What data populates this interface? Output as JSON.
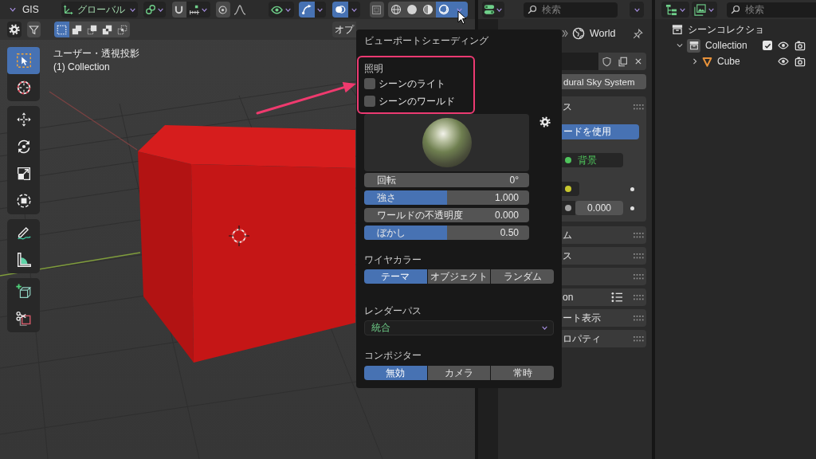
{
  "viewport_header": {
    "menu_label": "GIS",
    "orientation": {
      "value": "グローバル"
    },
    "snap": {
      "on": false
    },
    "proportional_editing": {
      "on": false
    },
    "gizmos": {
      "on": true
    },
    "overlays": {
      "on": true
    },
    "xray": {
      "on": false
    },
    "shading_modes": [
      {
        "selected": false
      },
      {
        "selected": false
      },
      {
        "selected": false
      },
      {
        "selected": true
      }
    ],
    "shading_menu": {
      "expanded": true
    }
  },
  "tool_header": {
    "select_modes": [
      {
        "selected": true
      },
      {
        "selected": false
      },
      {
        "selected": false
      },
      {
        "selected": false
      },
      {
        "selected": false
      }
    ],
    "options_button": "オプ"
  },
  "viewport": {
    "view_name": "ユーザー・透視投影",
    "collection_label": "(1) Collection",
    "toolbar": [
      {
        "tools": [
          {
            "selected": true
          },
          {
            "selected": false
          }
        ]
      },
      {
        "tools": [
          {
            "selected": false
          },
          {
            "selected": false
          },
          {
            "selected": false
          },
          {
            "selected": false
          }
        ]
      },
      {
        "tools": [
          {
            "selected": false
          },
          {
            "selected": false
          }
        ]
      },
      {
        "tools": [
          {
            "selected": false
          },
          {
            "selected": false
          }
        ]
      }
    ]
  },
  "viewport_shading": {
    "title": "ビューポートシェーディング",
    "lighting": {
      "label": "照明",
      "highlighted": true,
      "options": [
        {
          "label": "シーンのライト",
          "checked": false
        },
        {
          "label": "シーンのワールド",
          "checked": false
        }
      ]
    },
    "sliders": [
      {
        "kind": "number",
        "label": "回転",
        "value": "0°"
      },
      {
        "kind": "slider",
        "label": "強さ",
        "value": "1.000",
        "level": 0.5
      },
      {
        "kind": "number",
        "label": "ワールドの不透明度",
        "value": "0.000"
      },
      {
        "kind": "slider",
        "label": "ぼかし",
        "value": "0.50",
        "level": 0.5
      }
    ],
    "wire_color": {
      "label": "ワイヤカラー",
      "options": [
        {
          "label": "テーマ",
          "selected": true
        },
        {
          "label": "オブジェクト",
          "selected": false
        },
        {
          "label": "ランダム",
          "selected": false
        }
      ]
    },
    "render_pass": {
      "label": "レンダーパス",
      "value": "統合"
    },
    "compositor": {
      "label": "コンポジター",
      "options": [
        {
          "label": "無効",
          "selected": true
        },
        {
          "label": "カメラ",
          "selected": false
        },
        {
          "label": "常時",
          "selected": false
        }
      ]
    }
  },
  "properties": {
    "search": {
      "placeholder": "検索"
    },
    "breadcrumb": "World",
    "node_tree_button": "dural Sky System",
    "panels": [
      {
        "title": "ス",
        "expanded": true,
        "use_nodes": {
          "label": "ードを使用",
          "on": true
        },
        "sockets": [
          {
            "kind": "shader",
            "label": "背景",
            "color": "#4fc45c"
          },
          {
            "kind": "color",
            "color": "#c7c72e"
          },
          {
            "kind": "value",
            "color": "#a1a1a1",
            "value": "0.000"
          }
        ]
      },
      {
        "title": "ム",
        "expanded": false,
        "menu_icon": false
      },
      {
        "title": "ス",
        "expanded": false,
        "menu_icon": false
      },
      {
        "expanded": false,
        "menu_icon": false
      },
      {
        "title": "on",
        "expanded": false,
        "menu_icon": true
      },
      {
        "title": "ート表示",
        "expanded": false,
        "menu_icon": false
      },
      {
        "title": "ロパティ",
        "expanded": false,
        "menu_icon": false
      }
    ]
  },
  "outliner": {
    "search": {
      "placeholder": "検索"
    },
    "tree": [
      {
        "kind": "scene_collection",
        "label": "シーンコレクショ",
        "children": [
          {
            "kind": "collection",
            "label": "Collection",
            "expanded": true,
            "included": true,
            "children": [
              {
                "kind": "mesh",
                "label": "Cube",
                "expanded": false
              }
            ]
          }
        ]
      }
    ]
  }
}
